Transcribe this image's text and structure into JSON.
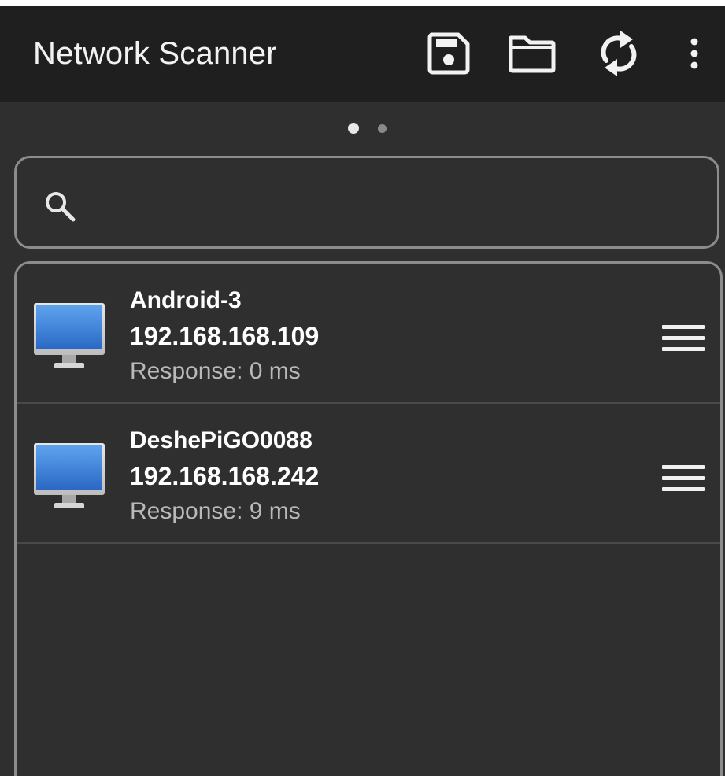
{
  "appbar": {
    "title": "Network Scanner",
    "actions": [
      {
        "icon": "save-icon"
      },
      {
        "icon": "folder-icon"
      },
      {
        "icon": "refresh-icon"
      },
      {
        "icon": "more-vert-icon"
      }
    ],
    "background": "#1f1f1f"
  },
  "pager": {
    "pages": 2,
    "current": 1
  },
  "search": {
    "value": "",
    "placeholder": "",
    "icon": "search-icon"
  },
  "devices": [
    {
      "hostname": "Android-3",
      "ip": "192.168.168.109",
      "response": "Response: 0 ms",
      "icon": "monitor-icon"
    },
    {
      "hostname": "DeshePiGO0088",
      "ip": "192.168.168.242",
      "response": "Response: 9 ms",
      "icon": "monitor-icon"
    }
  ],
  "colors": {
    "background": "#2f2f2f",
    "border": "#8c8c8c",
    "text_primary": "#ffffff",
    "text_secondary": "#b9b9b9",
    "monitor_blue": "#3a7fd6"
  }
}
